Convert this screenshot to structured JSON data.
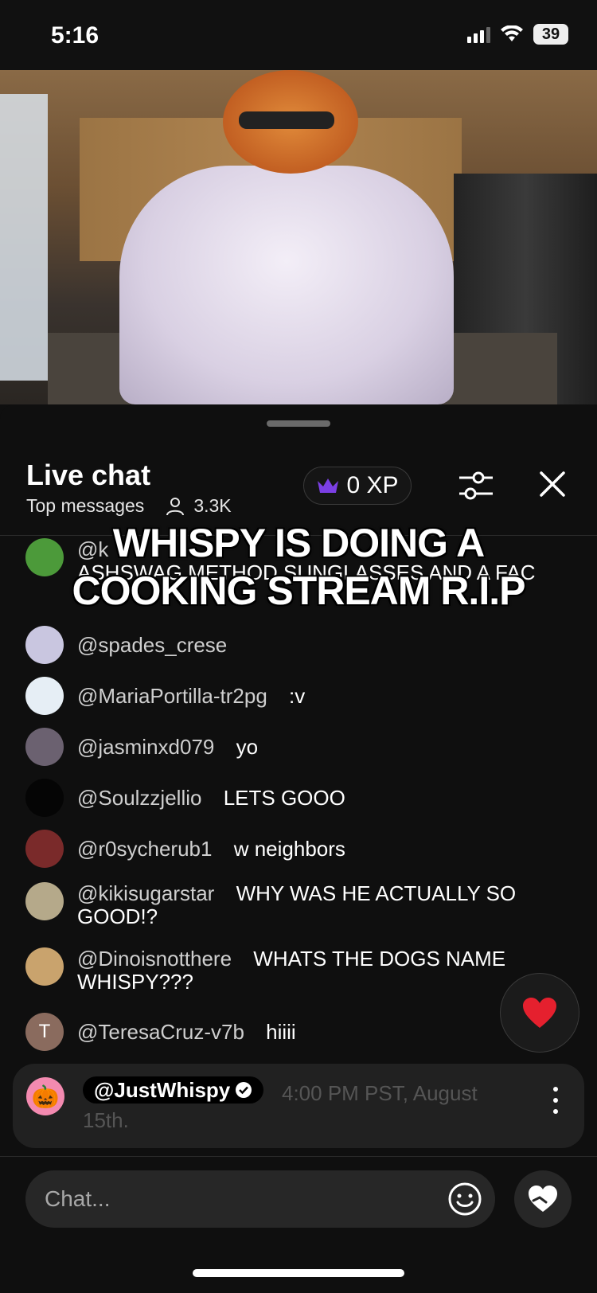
{
  "status_bar": {
    "time": "5:16",
    "battery": "39"
  },
  "video": {
    "description_icon": "livestream-video"
  },
  "chat_header": {
    "title": "Live chat",
    "mode": "Top messages",
    "viewers": "3.3K",
    "xp": "0 XP"
  },
  "overlay_caption": "WHISPY IS DOING A COOKING STREAM R.I.P",
  "messages": [
    {
      "author": "@k",
      "text": "ASHSWAG METHOD SUNGLASSES AND A FAC",
      "avatar_color": "#4c9a3a",
      "avatar_letter": ""
    },
    {
      "author": "@spades_crese",
      "text": "",
      "avatar_color": "#c9c6e0",
      "avatar_letter": ""
    },
    {
      "author": "@MariaPortilla-tr2pg",
      "text": ":v",
      "avatar_color": "#e6eef5",
      "avatar_letter": ""
    },
    {
      "author": "@jasminxd079",
      "text": "yo",
      "avatar_color": "#6b6170",
      "avatar_letter": ""
    },
    {
      "author": "@Soulzzjellio",
      "text": "LETS GOOO",
      "avatar_color": "#050505",
      "avatar_letter": ""
    },
    {
      "author": "@r0sycherub1",
      "text": "w neighbors",
      "avatar_color": "#7a2a2a",
      "avatar_letter": ""
    },
    {
      "author": "@kikisugarstar",
      "text": "WHY WAS HE ACTUALLY SO GOOD!?",
      "avatar_color": "#b5a98a",
      "avatar_letter": ""
    },
    {
      "author": "@Dinoisnotthere",
      "text": "WHATS THE DOGS NAME WHISPY???",
      "avatar_color": "#c9a36d",
      "avatar_letter": ""
    },
    {
      "author": "@TeresaCruz-v7b",
      "text": "hiiii",
      "avatar_color": "#8a6b5e",
      "avatar_letter": "T"
    }
  ],
  "pinned": {
    "author": "@JustWhispy",
    "text": "4:00 PM PST, August 15th.",
    "avatar_color": "#f38ab0"
  },
  "composer": {
    "placeholder": "Chat..."
  },
  "colors": {
    "accent_purple": "#7b3fe4",
    "heart_red": "#e5202e",
    "background": "#0f0f0f"
  }
}
